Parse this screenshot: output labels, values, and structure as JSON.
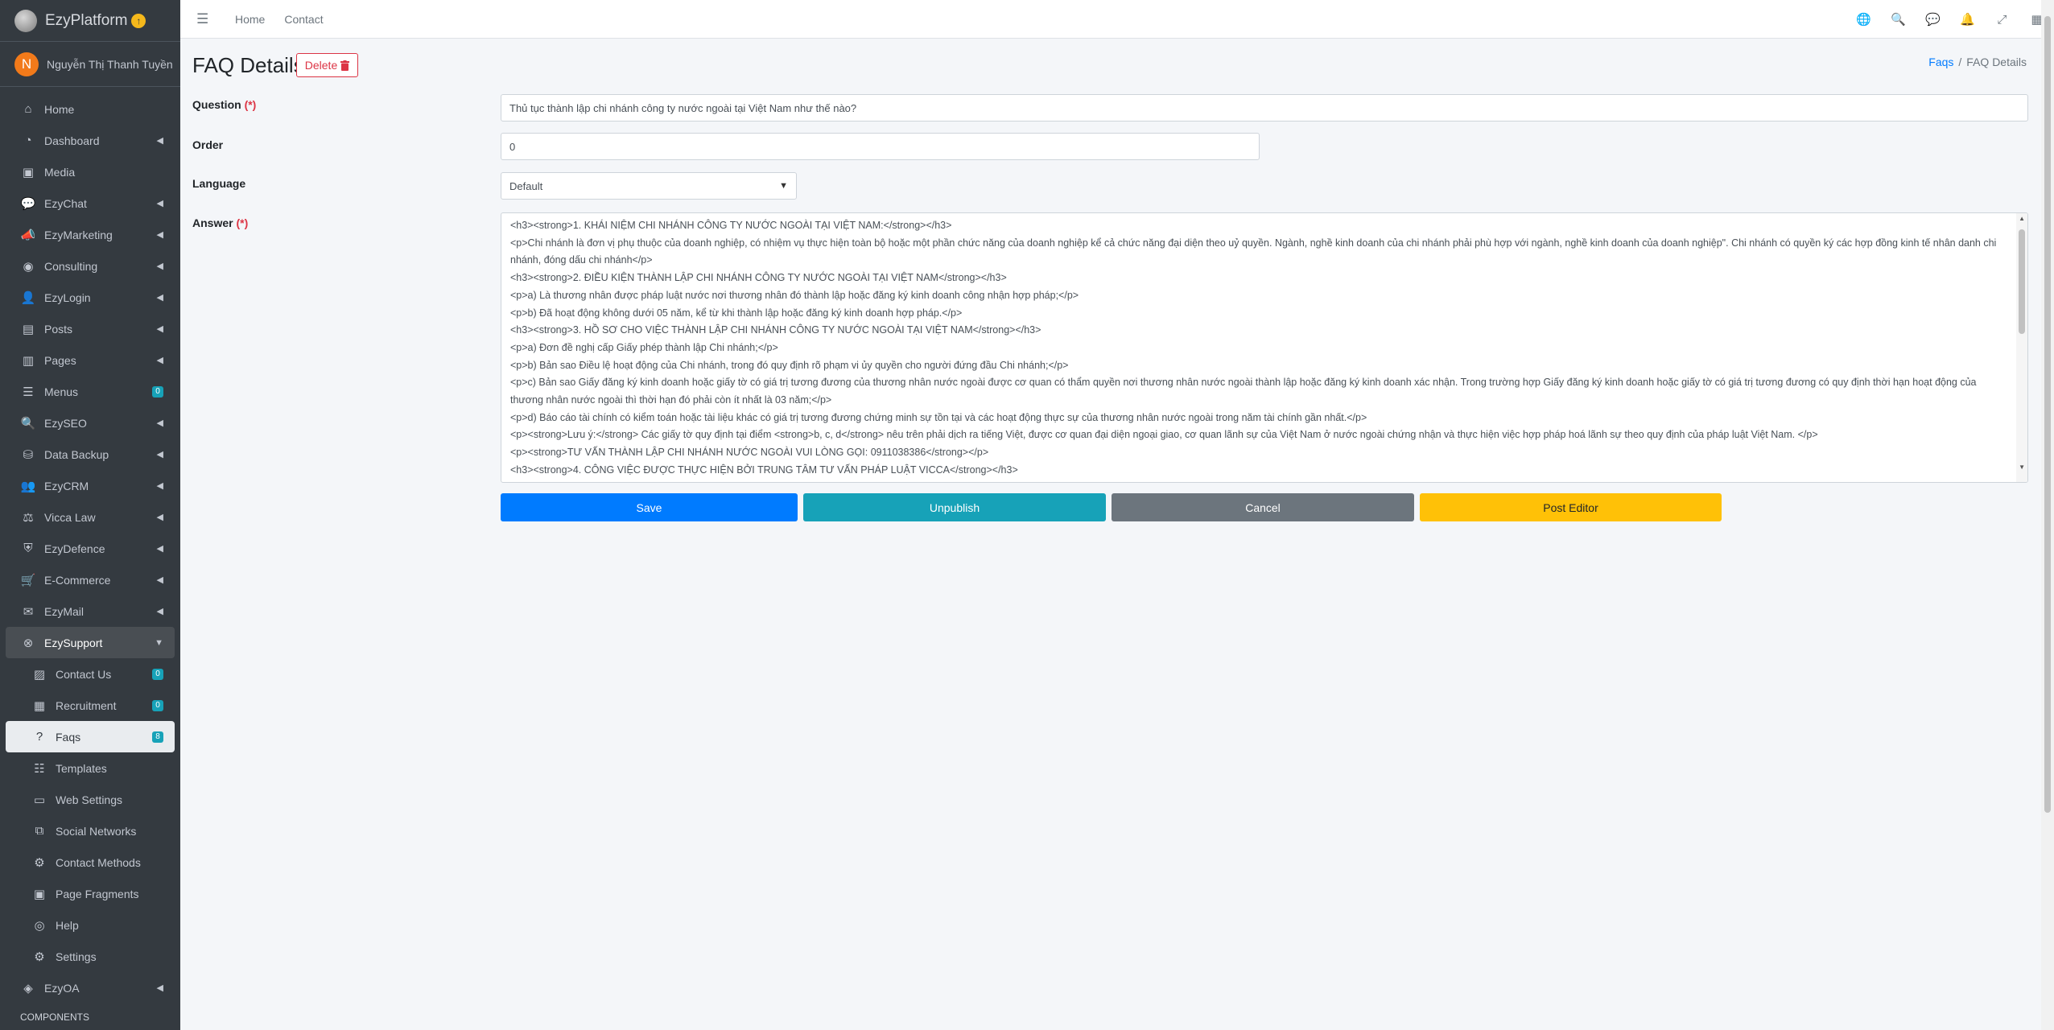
{
  "brand": {
    "name": "EzyPlatform",
    "badge": "↑"
  },
  "user": {
    "initial": "N",
    "name": "Nguyễn Thị Thanh Tuyền"
  },
  "sidebar": {
    "items": [
      {
        "icon": "⌂",
        "icon_name": "home-icon",
        "label": "Home",
        "arrow": ""
      },
      {
        "icon": "◔",
        "icon_name": "dashboard-icon",
        "label": "Dashboard",
        "arrow": "◀"
      },
      {
        "icon": "▣",
        "icon_name": "media-icon",
        "label": "Media",
        "arrow": ""
      },
      {
        "icon": "💬",
        "icon_name": "chat-icon",
        "label": "EzyChat",
        "arrow": "◀"
      },
      {
        "icon": "📣",
        "icon_name": "bullhorn-icon",
        "label": "EzyMarketing",
        "arrow": "◀"
      },
      {
        "icon": "◉",
        "icon_name": "consulting-icon",
        "label": "Consulting",
        "arrow": "◀"
      },
      {
        "icon": "👤",
        "icon_name": "user-lock-icon",
        "label": "EzyLogin",
        "arrow": "◀"
      },
      {
        "icon": "▤",
        "icon_name": "posts-icon",
        "label": "Posts",
        "arrow": "◀"
      },
      {
        "icon": "▥",
        "icon_name": "pages-icon",
        "label": "Pages",
        "arrow": "◀"
      },
      {
        "icon": "☰",
        "icon_name": "menus-icon",
        "label": "Menus",
        "badge": "0"
      },
      {
        "icon": "🔍",
        "icon_name": "seo-icon",
        "label": "EzySEO",
        "arrow": "◀"
      },
      {
        "icon": "⛁",
        "icon_name": "database-icon",
        "label": "Data Backup",
        "arrow": "◀"
      },
      {
        "icon": "👥",
        "icon_name": "crm-icon",
        "label": "EzyCRM",
        "arrow": "◀"
      },
      {
        "icon": "⚖",
        "icon_name": "gavel-icon",
        "label": "Vicca Law",
        "arrow": "◀"
      },
      {
        "icon": "⛨",
        "icon_name": "shield-icon",
        "label": "EzyDefence",
        "arrow": "◀"
      },
      {
        "icon": "🛒",
        "icon_name": "cart-icon",
        "label": "E-Commerce",
        "arrow": "◀"
      },
      {
        "icon": "✉",
        "icon_name": "mail-icon",
        "label": "EzyMail",
        "arrow": "◀"
      }
    ],
    "support": {
      "icon": "⊗",
      "icon_name": "life-ring-icon",
      "label": "EzySupport",
      "arrow": "▼"
    },
    "sub_items": [
      {
        "icon": "▨",
        "icon_name": "contact-card-icon",
        "label": "Contact Us",
        "badge": "0"
      },
      {
        "icon": "▦",
        "icon_name": "recruitment-icon",
        "label": "Recruitment",
        "badge": "0"
      },
      {
        "icon": "?",
        "icon_name": "question-circle-icon",
        "label": "Faqs",
        "badge": "8",
        "active": true
      },
      {
        "icon": "☷",
        "icon_name": "templates-icon",
        "label": "Templates"
      },
      {
        "icon": "▭",
        "icon_name": "window-icon",
        "label": "Web Settings"
      },
      {
        "icon": "⧉",
        "icon_name": "social-icon",
        "label": "Social Networks"
      },
      {
        "icon": "⚙",
        "icon_name": "cogs-icon",
        "label": "Contact Methods"
      },
      {
        "icon": "▣",
        "icon_name": "fragment-icon",
        "label": "Page Fragments"
      },
      {
        "icon": "◎",
        "icon_name": "help-icon",
        "label": "Help"
      },
      {
        "icon": "⚙",
        "icon_name": "settings-icon",
        "label": "Settings"
      }
    ],
    "after": {
      "icon": "◈",
      "icon_name": "oa-icon",
      "label": "EzyOA",
      "arrow": "◀"
    },
    "header": "COMPONENTS"
  },
  "topbar": {
    "menu_icon": "☰",
    "links": [
      "Home",
      "Contact"
    ],
    "icons": [
      "🌐",
      "🔍",
      "💬",
      "🔔",
      "⤢",
      "▦"
    ]
  },
  "page": {
    "title": "FAQ Details",
    "delete_label": "Delete",
    "breadcrumb": {
      "parent": "Faqs",
      "separator": "/",
      "current": "FAQ Details"
    }
  },
  "form": {
    "question_label": "Question",
    "required_mark": "(*)",
    "question_value": "Thủ tục thành lập chi nhánh công ty nước ngoài tại Việt Nam như thế nào?",
    "order_label": "Order",
    "order_value": "0",
    "language_label": "Language",
    "language_value": "Default",
    "answer_label": "Answer",
    "answer_lines": [
      "<h3><strong>1. KHÁI NIỆM CHI NHÁNH CÔNG TY NƯỚC NGOÀI TẠI VIỆT NAM:</strong></h3>",
      "<p>Chi nhánh là đơn vị phụ thuộc của doanh nghiệp, có nhiệm vụ thực hiện toàn bộ hoặc một phần chức năng của doanh nghiệp kể cả chức năng đại diện theo uỷ quyền. Ngành, nghề kinh doanh của chi nhánh phải phù hợp với ngành, nghề kinh doanh của doanh nghiệp\". Chi nhánh có quyền ký các hợp đồng kinh tế nhân danh chi nhánh, đóng dấu chi nhánh</p>",
      "<h3><strong>2. ĐIỀU KIỆN THÀNH LẬP CHI NHÁNH CÔNG TY NƯỚC NGOÀI TẠI VIỆT NAM</strong></h3>",
      "<p>a) Là thương nhân được pháp luật nước nơi thương nhân đó thành lập hoặc đăng ký kinh doanh công nhận hợp pháp;</p>",
      "<p>b) Đã hoạt động không dưới 05 năm, kể từ khi thành lập hoặc đăng ký kinh doanh hợp pháp.</p>",
      "<h3><strong>3. HỒ SƠ CHO VIỆC THÀNH LẬP CHI NHÁNH CÔNG TY NƯỚC NGOÀI TẠI VIỆT NAM</strong></h3>",
      "<p>a) Đơn đề nghị cấp Giấy phép thành lập Chi nhánh;</p>",
      "<p>b) Bản sao Điều lệ hoạt động của Chi nhánh, trong đó quy định rõ phạm vi ủy quyền cho người đứng đầu Chi nhánh;</p>",
      "<p>c) Bản sao Giấy đăng ký kinh doanh hoặc giấy tờ có giá trị tương đương của thương nhân nước ngoài được cơ quan có thẩm quyền nơi thương nhân nước ngoài thành lập hoặc đăng ký kinh doanh xác nhận. Trong trường hợp Giấy đăng ký kinh doanh hoặc giấy tờ có giá trị tương đương có quy định thời hạn hoạt động của thương nhân nước ngoài thì thời hạn đó phải còn ít nhất là 03 năm;</p>",
      "<p>d) Báo cáo tài chính có kiểm toán hoặc tài liệu khác có giá trị tương đương chứng minh sự tồn tại và các hoạt động thực sự của thương nhân nước ngoài trong năm tài chính gần nhất.</p>",
      "<p><strong>Lưu ý:</strong> Các giấy tờ quy định tại điểm <strong>b, c, d</strong> nêu trên phải dịch ra tiếng Việt, được cơ quan đại diện ngoại giao, cơ quan lãnh sự của Việt Nam ở nước ngoài chứng nhận và thực hiện việc hợp pháp hoá lãnh sự theo quy định của pháp luật Việt Nam. </p>",
      "<p><strong>TƯ VẤN THÀNH LẬP CHI NHÁNH NƯỚC NGOÀI VUI LÒNG GỌI: 0911038386</strong></p>",
      "<h3><strong>4.  CÔNG VIỆC ĐƯỢC THỰC HIỆN BỞI TRUNG TÂM TƯ VẤN PHÁP LUẬT VICCA</strong></h3>"
    ]
  },
  "buttons": {
    "save": "Save",
    "unpublish": "Unpublish",
    "cancel": "Cancel",
    "post_editor": "Post Editor"
  }
}
